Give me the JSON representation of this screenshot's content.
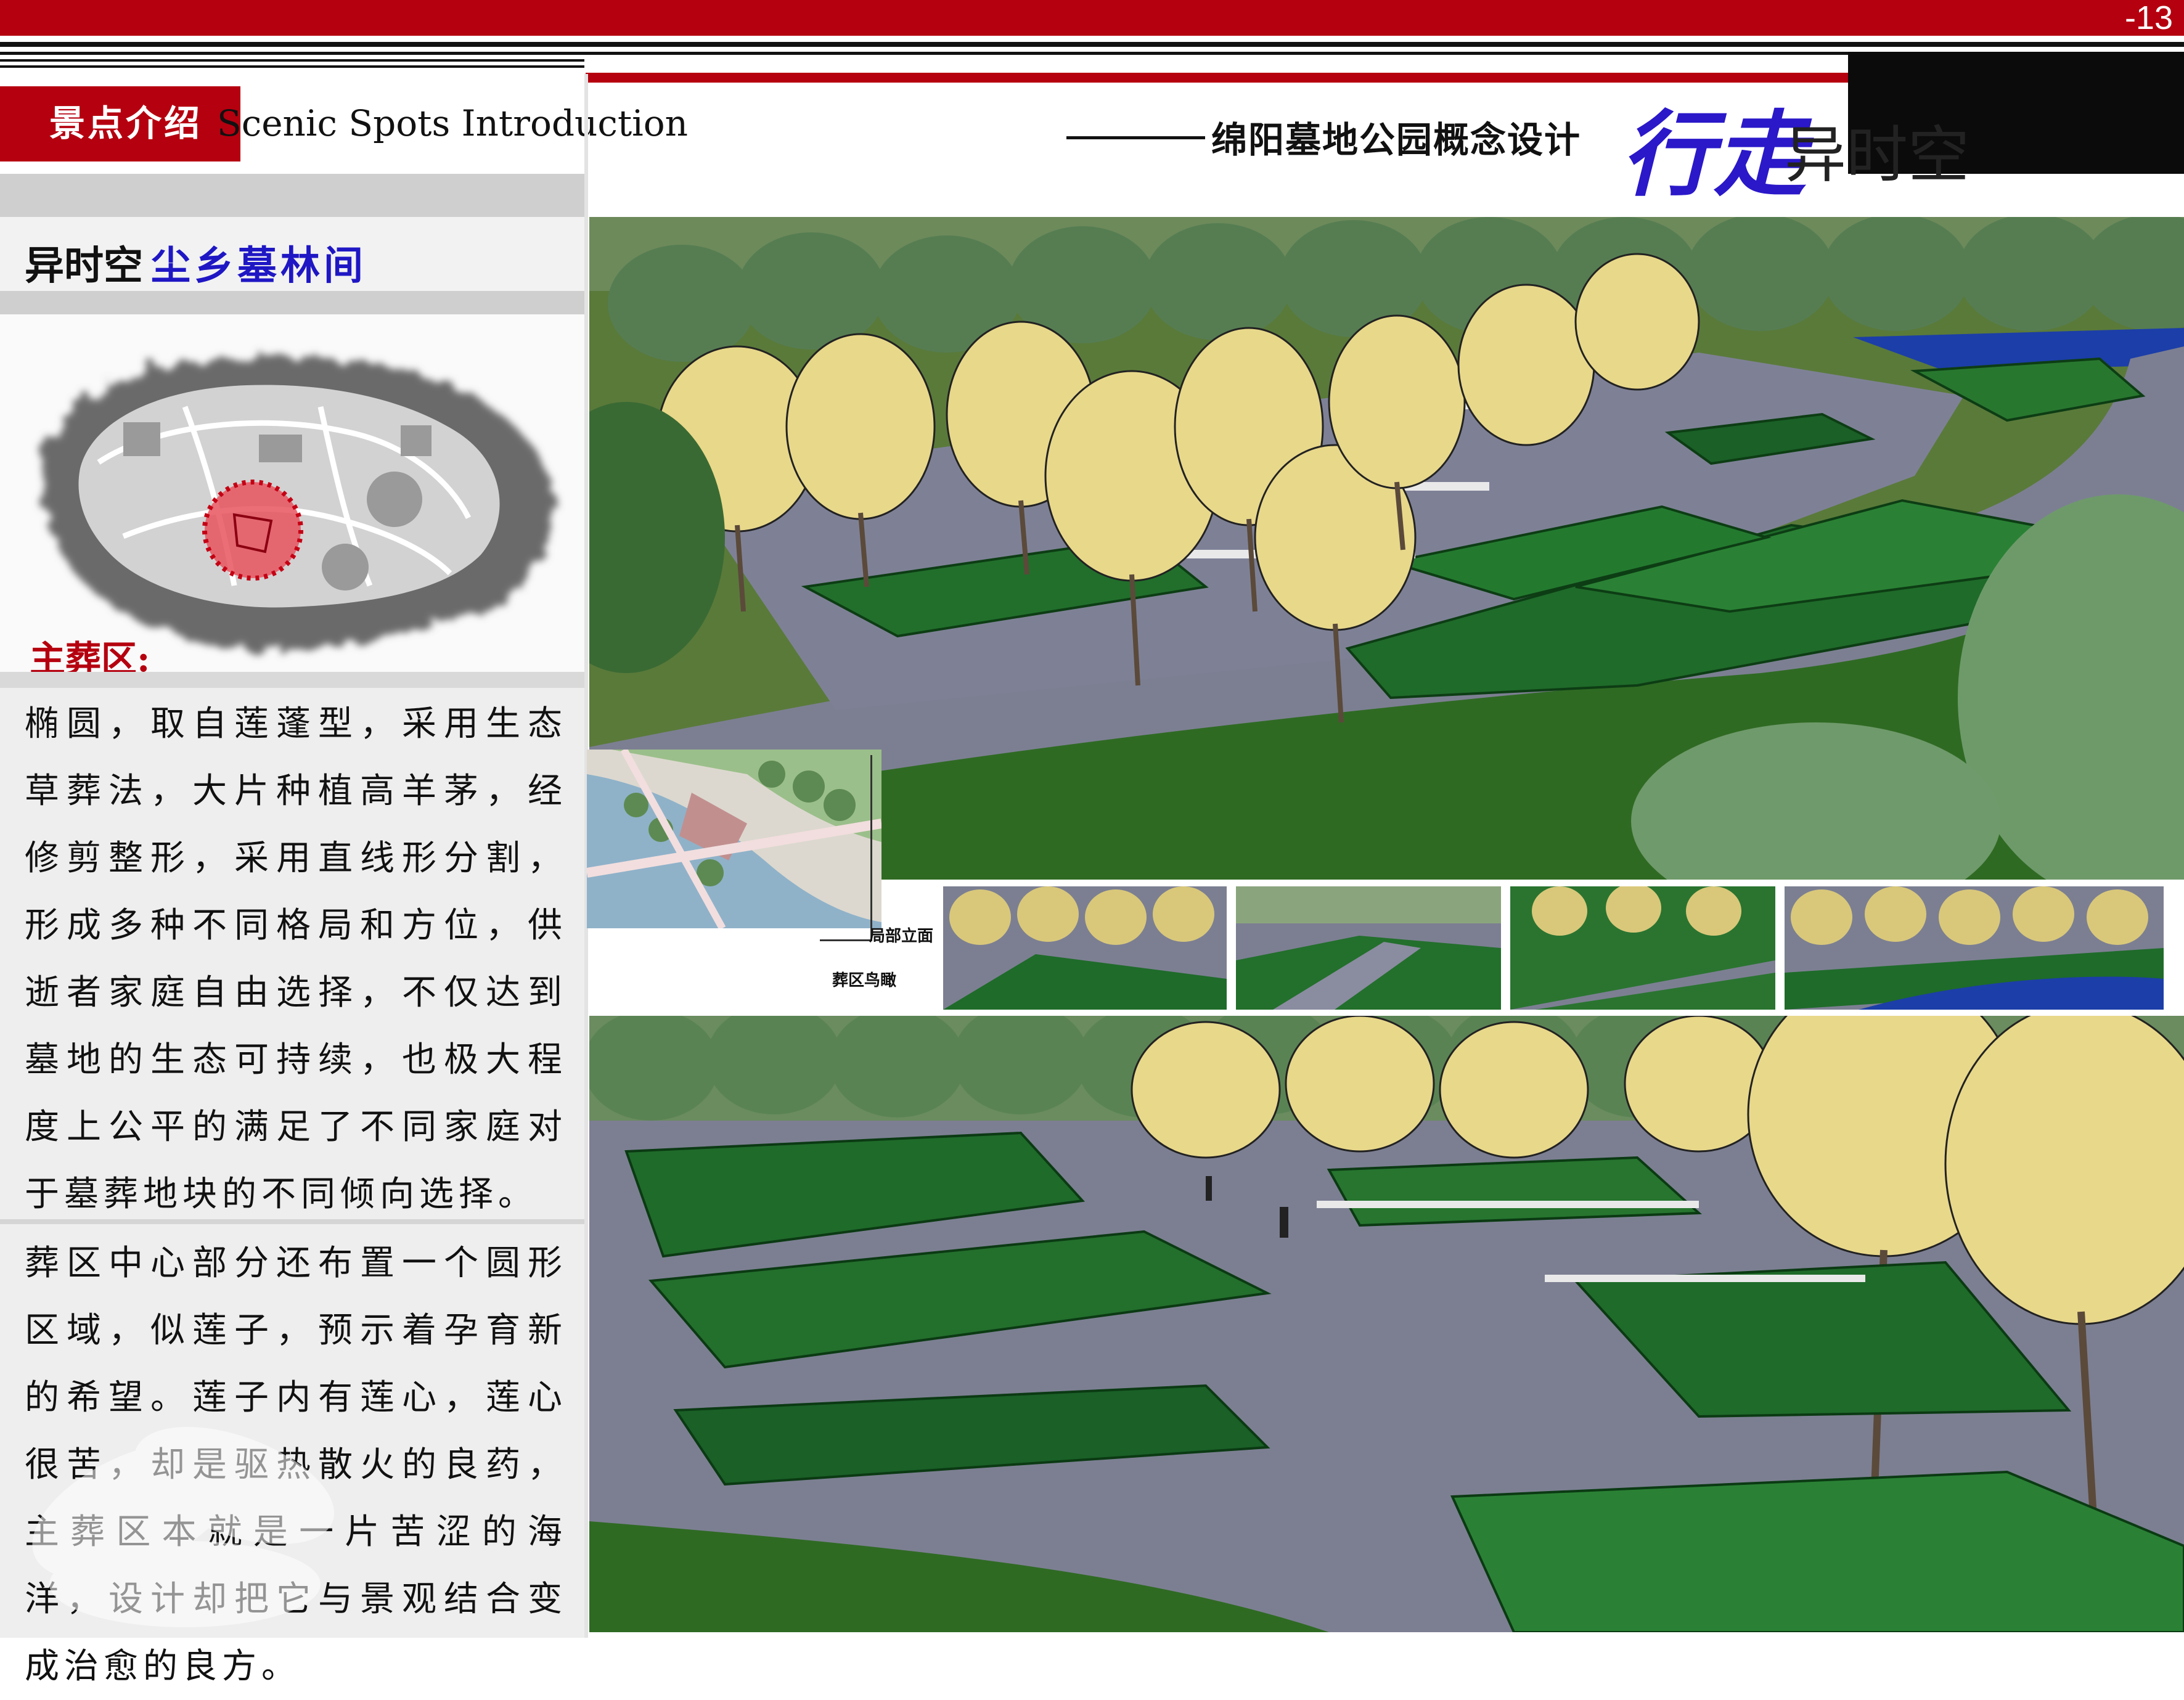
{
  "page": {
    "number": "-13"
  },
  "header": {
    "section_cn": "景点介绍",
    "section_en": "Scenic Spots Introduction",
    "subtitle": "绵阳墓地公园概念设计",
    "brand_part1": "行走",
    "brand_part2": "异时空"
  },
  "spot": {
    "title_prefix": "异时空",
    "title_name": "尘乡墓林间",
    "zone_label": "主葬区:"
  },
  "description": {
    "paragraph_1": "椭圆，取自莲蓬型，采用生态草葬法，大片种植高羊茅，经修剪整形，采用直线形分割，形成多种不同格局和方位，供逝者家庭自由选择，不仅达到墓地的生态可持续，也极大程度上公平的满足了不同家庭对于墓葬地块的不同倾向选择。",
    "paragraph_2": "葬区中心部分还布置一个圆形区域，似莲子，预示着孕育新的希望。莲子内有莲心，莲心很苦，却是驱热散火的良药，主葬区本就是一片苦涩的海洋，设计却把它与景观结合变成治愈的良方。"
  },
  "figures": {
    "label_elevation": "局部立面",
    "label_aerial": "葬区鸟瞰"
  },
  "colors": {
    "accent_red": "#b5000f",
    "brand_blue": "#2a18c9",
    "grass_green": "#1f6b2a",
    "path_gray": "#7c7f92"
  }
}
